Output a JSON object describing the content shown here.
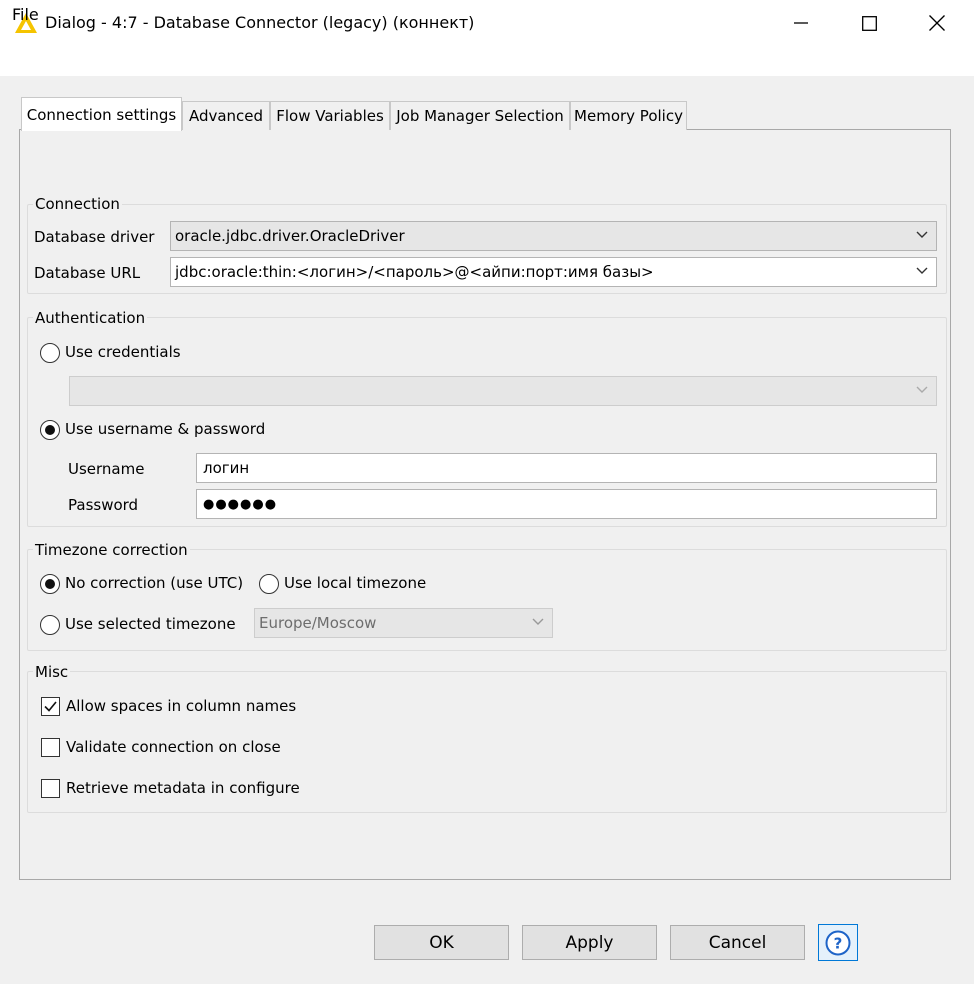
{
  "window": {
    "title": "Dialog - 4:7 - Database Connector (legacy) (коннект)"
  },
  "menu": {
    "file": "File"
  },
  "tabs": [
    {
      "label": "Connection settings"
    },
    {
      "label": "Advanced"
    },
    {
      "label": "Flow Variables"
    },
    {
      "label": "Job Manager Selection"
    },
    {
      "label": "Memory Policy"
    }
  ],
  "connection": {
    "title": "Connection",
    "driver_label": "Database driver",
    "driver_value": "oracle.jdbc.driver.OracleDriver",
    "url_label": "Database URL",
    "url_value": "jdbc:oracle:thin:<логин>/<пароль>@<айпи:порт:имя базы>"
  },
  "authentication": {
    "title": "Authentication",
    "use_credentials": "Use credentials",
    "use_username_password": "Use username & password",
    "username_label": "Username",
    "username_value": "логин",
    "password_label": "Password",
    "password_value": "●●●●●●"
  },
  "timezone": {
    "title": "Timezone correction",
    "no_correction": "No correction (use UTC)",
    "local": "Use local timezone",
    "selected": "Use selected timezone",
    "selected_value": "Europe/Moscow"
  },
  "misc": {
    "title": "Misc",
    "allow_spaces": "Allow spaces in column names",
    "validate": "Validate connection on close",
    "retrieve": "Retrieve metadata in configure"
  },
  "buttons": {
    "ok": "OK",
    "apply": "Apply",
    "cancel": "Cancel",
    "help": "?"
  },
  "colors": {
    "accent": "#0078d7",
    "warning_icon": "#f5c400"
  }
}
